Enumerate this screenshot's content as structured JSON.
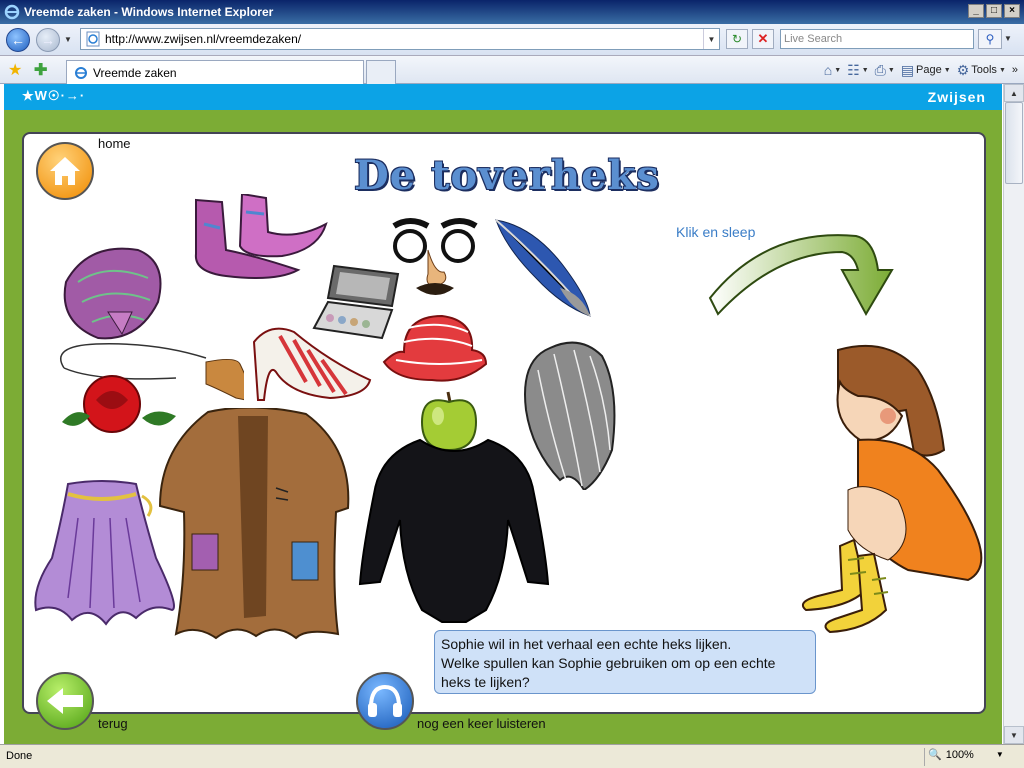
{
  "window": {
    "title": "Vreemde zaken - Windows Internet Explorer",
    "buttons": [
      "_",
      "□",
      "×"
    ]
  },
  "address": {
    "url": "http://www.zwijsen.nl/vreemdezaken/",
    "search_placeholder": "Live Search"
  },
  "tabs": {
    "active_label": "Vreemde zaken"
  },
  "commandbar": {
    "page_label": "Page",
    "tools_label": "Tools",
    "more": "»"
  },
  "site": {
    "logo": "★W☉·→·",
    "brand": "Zwijsen"
  },
  "stage": {
    "title": "De toverheks",
    "home_label": "home",
    "back_label": "terug",
    "listen_label": "nog een keer luisteren",
    "hint": "Klik en sleep",
    "speech_line1": "Sophie wil in het verhaal een echte heks lijken.",
    "speech_line2": "Welke spullen kan Sophie gebruiken om op een echte",
    "speech_line3": "heks te lijken?"
  },
  "statusbar": {
    "status": "Done",
    "zoom": "100%"
  },
  "colors": {
    "site_bar": "#0ca3e6",
    "frame_green": "#7cac35",
    "title_blue": "#5b8fd0",
    "speech_bg": "#cfe1f8"
  }
}
